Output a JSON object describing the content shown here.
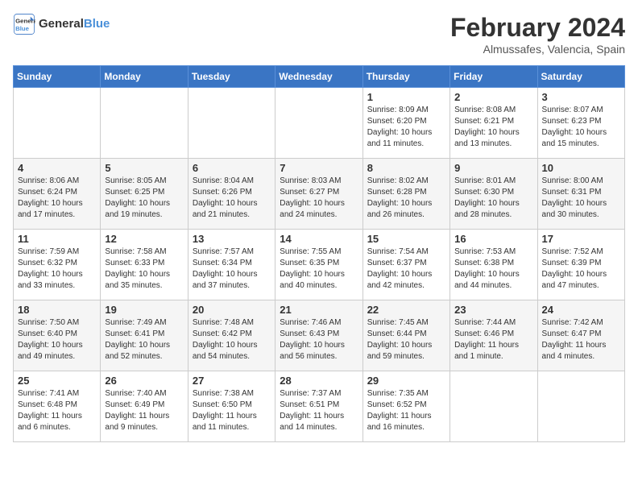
{
  "header": {
    "logo_line1": "General",
    "logo_line2": "Blue",
    "month_title": "February 2024",
    "location": "Almussafes, Valencia, Spain"
  },
  "days_of_week": [
    "Sunday",
    "Monday",
    "Tuesday",
    "Wednesday",
    "Thursday",
    "Friday",
    "Saturday"
  ],
  "weeks": [
    [
      {
        "day": "",
        "info": ""
      },
      {
        "day": "",
        "info": ""
      },
      {
        "day": "",
        "info": ""
      },
      {
        "day": "",
        "info": ""
      },
      {
        "day": "1",
        "info": "Sunrise: 8:09 AM\nSunset: 6:20 PM\nDaylight: 10 hours\nand 11 minutes."
      },
      {
        "day": "2",
        "info": "Sunrise: 8:08 AM\nSunset: 6:21 PM\nDaylight: 10 hours\nand 13 minutes."
      },
      {
        "day": "3",
        "info": "Sunrise: 8:07 AM\nSunset: 6:23 PM\nDaylight: 10 hours\nand 15 minutes."
      }
    ],
    [
      {
        "day": "4",
        "info": "Sunrise: 8:06 AM\nSunset: 6:24 PM\nDaylight: 10 hours\nand 17 minutes."
      },
      {
        "day": "5",
        "info": "Sunrise: 8:05 AM\nSunset: 6:25 PM\nDaylight: 10 hours\nand 19 minutes."
      },
      {
        "day": "6",
        "info": "Sunrise: 8:04 AM\nSunset: 6:26 PM\nDaylight: 10 hours\nand 21 minutes."
      },
      {
        "day": "7",
        "info": "Sunrise: 8:03 AM\nSunset: 6:27 PM\nDaylight: 10 hours\nand 24 minutes."
      },
      {
        "day": "8",
        "info": "Sunrise: 8:02 AM\nSunset: 6:28 PM\nDaylight: 10 hours\nand 26 minutes."
      },
      {
        "day": "9",
        "info": "Sunrise: 8:01 AM\nSunset: 6:30 PM\nDaylight: 10 hours\nand 28 minutes."
      },
      {
        "day": "10",
        "info": "Sunrise: 8:00 AM\nSunset: 6:31 PM\nDaylight: 10 hours\nand 30 minutes."
      }
    ],
    [
      {
        "day": "11",
        "info": "Sunrise: 7:59 AM\nSunset: 6:32 PM\nDaylight: 10 hours\nand 33 minutes."
      },
      {
        "day": "12",
        "info": "Sunrise: 7:58 AM\nSunset: 6:33 PM\nDaylight: 10 hours\nand 35 minutes."
      },
      {
        "day": "13",
        "info": "Sunrise: 7:57 AM\nSunset: 6:34 PM\nDaylight: 10 hours\nand 37 minutes."
      },
      {
        "day": "14",
        "info": "Sunrise: 7:55 AM\nSunset: 6:35 PM\nDaylight: 10 hours\nand 40 minutes."
      },
      {
        "day": "15",
        "info": "Sunrise: 7:54 AM\nSunset: 6:37 PM\nDaylight: 10 hours\nand 42 minutes."
      },
      {
        "day": "16",
        "info": "Sunrise: 7:53 AM\nSunset: 6:38 PM\nDaylight: 10 hours\nand 44 minutes."
      },
      {
        "day": "17",
        "info": "Sunrise: 7:52 AM\nSunset: 6:39 PM\nDaylight: 10 hours\nand 47 minutes."
      }
    ],
    [
      {
        "day": "18",
        "info": "Sunrise: 7:50 AM\nSunset: 6:40 PM\nDaylight: 10 hours\nand 49 minutes."
      },
      {
        "day": "19",
        "info": "Sunrise: 7:49 AM\nSunset: 6:41 PM\nDaylight: 10 hours\nand 52 minutes."
      },
      {
        "day": "20",
        "info": "Sunrise: 7:48 AM\nSunset: 6:42 PM\nDaylight: 10 hours\nand 54 minutes."
      },
      {
        "day": "21",
        "info": "Sunrise: 7:46 AM\nSunset: 6:43 PM\nDaylight: 10 hours\nand 56 minutes."
      },
      {
        "day": "22",
        "info": "Sunrise: 7:45 AM\nSunset: 6:44 PM\nDaylight: 10 hours\nand 59 minutes."
      },
      {
        "day": "23",
        "info": "Sunrise: 7:44 AM\nSunset: 6:46 PM\nDaylight: 11 hours\nand 1 minute."
      },
      {
        "day": "24",
        "info": "Sunrise: 7:42 AM\nSunset: 6:47 PM\nDaylight: 11 hours\nand 4 minutes."
      }
    ],
    [
      {
        "day": "25",
        "info": "Sunrise: 7:41 AM\nSunset: 6:48 PM\nDaylight: 11 hours\nand 6 minutes."
      },
      {
        "day": "26",
        "info": "Sunrise: 7:40 AM\nSunset: 6:49 PM\nDaylight: 11 hours\nand 9 minutes."
      },
      {
        "day": "27",
        "info": "Sunrise: 7:38 AM\nSunset: 6:50 PM\nDaylight: 11 hours\nand 11 minutes."
      },
      {
        "day": "28",
        "info": "Sunrise: 7:37 AM\nSunset: 6:51 PM\nDaylight: 11 hours\nand 14 minutes."
      },
      {
        "day": "29",
        "info": "Sunrise: 7:35 AM\nSunset: 6:52 PM\nDaylight: 11 hours\nand 16 minutes."
      },
      {
        "day": "",
        "info": ""
      },
      {
        "day": "",
        "info": ""
      }
    ]
  ]
}
